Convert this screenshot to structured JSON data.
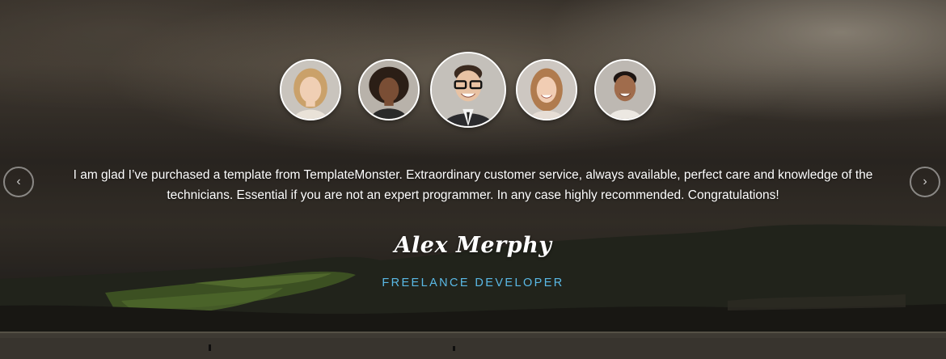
{
  "testimonial": {
    "quote": "I am glad I’ve purchased a template from TemplateMonster. Extraordinary customer service, always available, perfect care and knowledge of the technicians. Essential if you are not an expert programmer. In any case highly recommended. Congratulations!",
    "author": "Alex Merphy",
    "role": "FREELANCE DEVELOPER"
  },
  "avatars": [
    {
      "name": "avatar-blonde-woman",
      "active": false
    },
    {
      "name": "avatar-curly-hair-woman",
      "active": false
    },
    {
      "name": "avatar-man-glasses",
      "active": true
    },
    {
      "name": "avatar-smiling-woman",
      "active": false
    },
    {
      "name": "avatar-smiling-man",
      "active": false
    }
  ],
  "nav": {
    "prev_icon": "‹",
    "next_icon": "›"
  },
  "colors": {
    "role_accent": "#5ab9e6",
    "text": "#ffffff"
  }
}
